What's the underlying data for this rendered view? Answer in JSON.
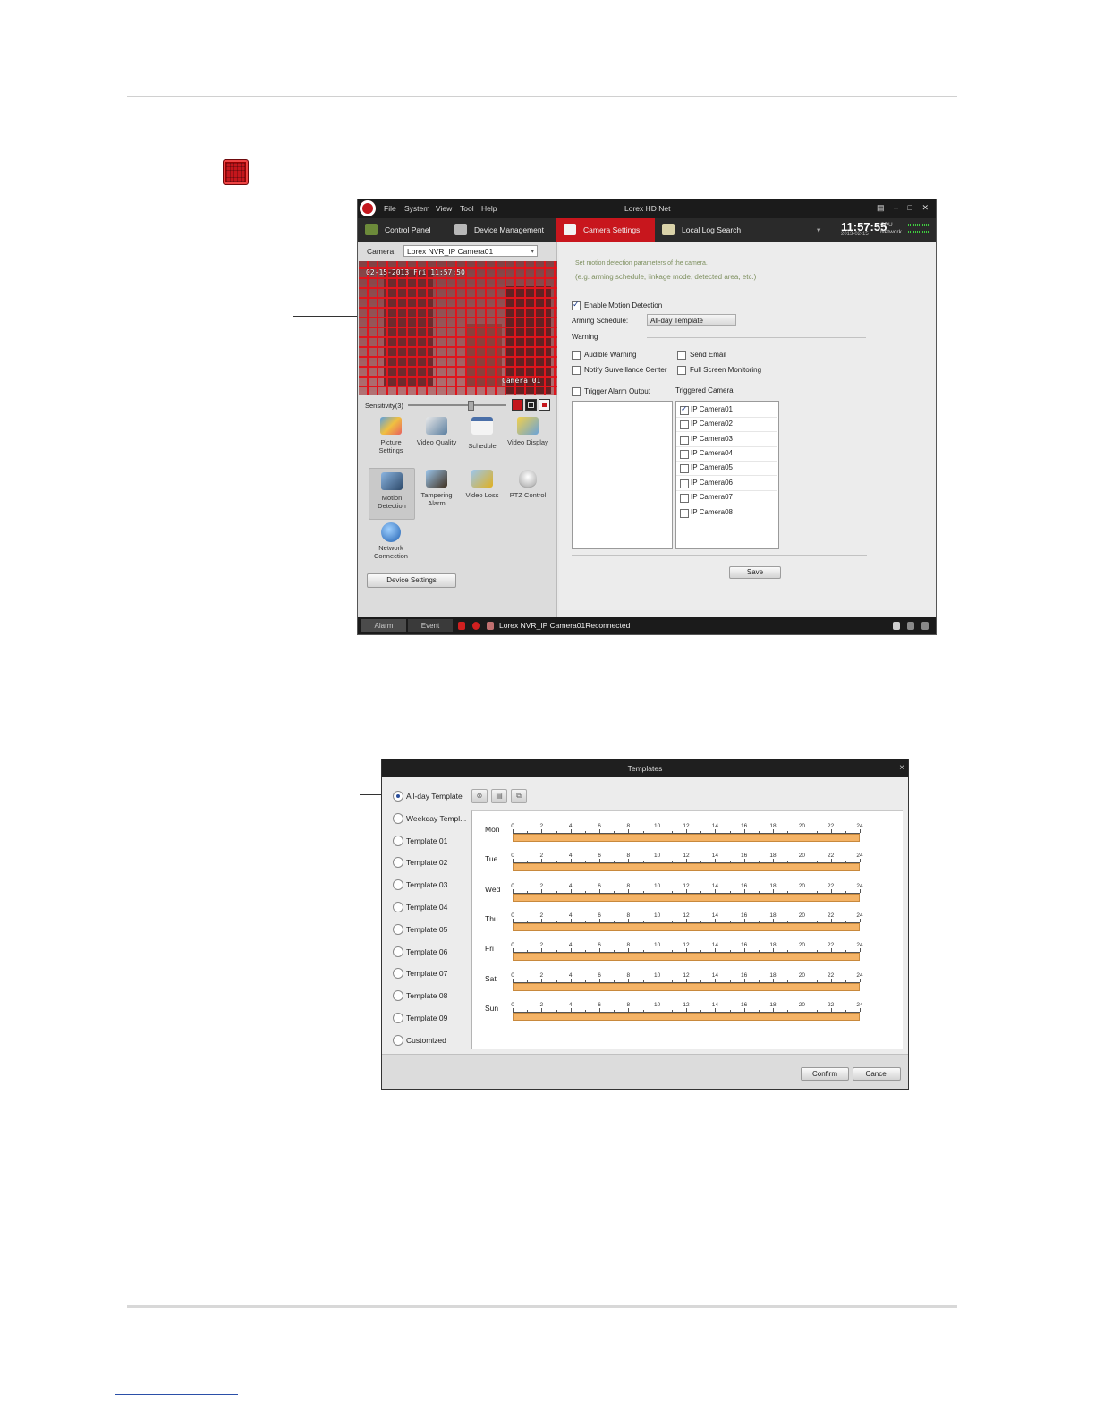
{
  "app": {
    "title": "Lorex HD Net",
    "menu": [
      "File",
      "System",
      "View",
      "Tool",
      "Help"
    ],
    "window_controls": "▤ – □ ✕",
    "tabs": [
      {
        "label": "Control Panel",
        "icon": "control-panel-icon",
        "active": false
      },
      {
        "label": "Device Management",
        "icon": "device-management-icon",
        "active": false
      },
      {
        "label": "Camera Settings",
        "icon": "camera-settings-icon",
        "active": true
      },
      {
        "label": "Local Log Search",
        "icon": "log-search-icon",
        "active": false
      }
    ],
    "tab_overflow": "▾",
    "clock": "11:57:55",
    "clock_date": "2013-02-15",
    "cpu_label": "CPU",
    "network_label": "Network",
    "accent_color": "#c8161d"
  },
  "left": {
    "camera_label": "Camera:",
    "camera_value": "Lorex NVR_IP Camera01",
    "osd_datetime": "02-15-2013 Fri 11:57:50",
    "osd_camera": "Camera 01",
    "sensitivity_label": "Sensitivity(3)",
    "sensitivity_value": 3,
    "settings_icons": [
      {
        "label": "Picture Settings",
        "icon": "picture-settings-icon"
      },
      {
        "label": "Video Quality",
        "icon": "video-quality-icon"
      },
      {
        "label": "Schedule",
        "icon": "schedule-icon"
      },
      {
        "label": "Video Display",
        "icon": "video-display-icon"
      },
      {
        "label": "Motion Detection",
        "icon": "motion-detection-icon",
        "selected": true
      },
      {
        "label": "Tampering Alarm",
        "icon": "tampering-alarm-icon"
      },
      {
        "label": "Video Loss",
        "icon": "video-loss-icon"
      },
      {
        "label": "PTZ Control",
        "icon": "ptz-control-icon"
      },
      {
        "label": "Network Connection",
        "icon": "network-connection-icon"
      }
    ],
    "device_settings": "Device Settings"
  },
  "right": {
    "hint_line1": "Set motion detection parameters of the camera.",
    "hint_line2": "(e.g. arming schedule, linkage mode, detected area, etc.)",
    "enable_motion": "Enable Motion Detection",
    "arming_schedule_label": "Arming Schedule:",
    "arming_schedule_value": "All-day Template",
    "warning_label": "Warning",
    "audible_warning": "Audible Warning",
    "send_email": "Send Email",
    "notify_center": "Notify Surveillance Center",
    "full_screen": "Full Screen Monitoring",
    "trigger_alarm": "Trigger Alarm Output",
    "triggered_camera": "Triggered Camera",
    "cameras": [
      {
        "name": "IP Camera01",
        "checked": true
      },
      {
        "name": "IP Camera02",
        "checked": false
      },
      {
        "name": "IP Camera03",
        "checked": false
      },
      {
        "name": "IP Camera04",
        "checked": false
      },
      {
        "name": "IP Camera05",
        "checked": false
      },
      {
        "name": "IP Camera06",
        "checked": false
      },
      {
        "name": "IP Camera07",
        "checked": false
      },
      {
        "name": "IP Camera08",
        "checked": false
      }
    ],
    "save": "Save"
  },
  "statusbar": {
    "alarm": "Alarm",
    "event": "Event",
    "message": "Lorex NVR_IP Camera01Reconnected"
  },
  "templates": {
    "title": "Templates",
    "close": "×",
    "options": [
      {
        "label": "All-day Template",
        "selected": true
      },
      {
        "label": "Weekday Templ...",
        "selected": false
      },
      {
        "label": "Template 01",
        "selected": false
      },
      {
        "label": "Template 02",
        "selected": false
      },
      {
        "label": "Template 03",
        "selected": false
      },
      {
        "label": "Template 04",
        "selected": false
      },
      {
        "label": "Template 05",
        "selected": false
      },
      {
        "label": "Template 06",
        "selected": false
      },
      {
        "label": "Template 07",
        "selected": false
      },
      {
        "label": "Template 08",
        "selected": false
      },
      {
        "label": "Template 09",
        "selected": false
      },
      {
        "label": "Customized",
        "selected": false
      }
    ],
    "toolbar_icons": [
      "clear-icon",
      "delete-icon",
      "copy-icon"
    ],
    "days": [
      "Mon",
      "Tue",
      "Wed",
      "Thu",
      "Fri",
      "Sat",
      "Sun"
    ],
    "hour_ticks": [
      "0",
      "2",
      "4",
      "6",
      "8",
      "10",
      "12",
      "14",
      "16",
      "18",
      "20",
      "22",
      "24"
    ],
    "schedule_start_hour": 0,
    "schedule_end_hour": 24,
    "schedule_color": "#f4b366",
    "confirm": "Confirm",
    "cancel": "Cancel"
  }
}
